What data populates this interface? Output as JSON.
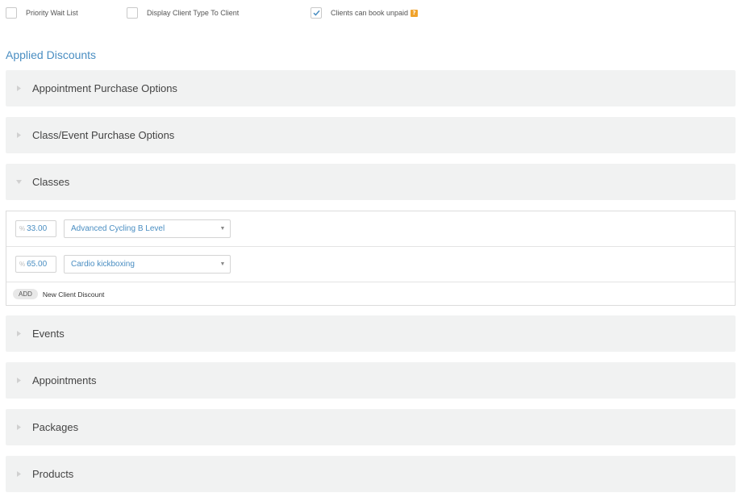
{
  "options": [
    {
      "label": "Priority Wait List",
      "checked": false,
      "help": false
    },
    {
      "label": "Display Client Type To Client",
      "checked": false,
      "help": false
    },
    {
      "label": "Clients can book unpaid",
      "checked": true,
      "help": true
    }
  ],
  "help_badge": "?",
  "section_title": "Applied Discounts",
  "panels_before": [
    {
      "label": "Appointment Purchase Options",
      "expanded": false
    },
    {
      "label": "Class/Event Purchase Options",
      "expanded": false
    },
    {
      "label": "Classes",
      "expanded": true
    }
  ],
  "classes_discounts": [
    {
      "percent_symbol": "%",
      "value": "33.00",
      "selection": "Advanced Cycling B Level"
    },
    {
      "percent_symbol": "%",
      "value": "65.00",
      "selection": "Cardio kickboxing"
    }
  ],
  "add_button": "ADD",
  "add_label": "New Client Discount",
  "panels_after": [
    {
      "label": "Events",
      "expanded": false
    },
    {
      "label": "Appointments",
      "expanded": false
    },
    {
      "label": "Packages",
      "expanded": false
    },
    {
      "label": "Products",
      "expanded": false
    }
  ],
  "colors": {
    "accent": "#4a8ec2",
    "panel_bg": "#f1f2f2",
    "help_badge": "#f0a32c"
  }
}
